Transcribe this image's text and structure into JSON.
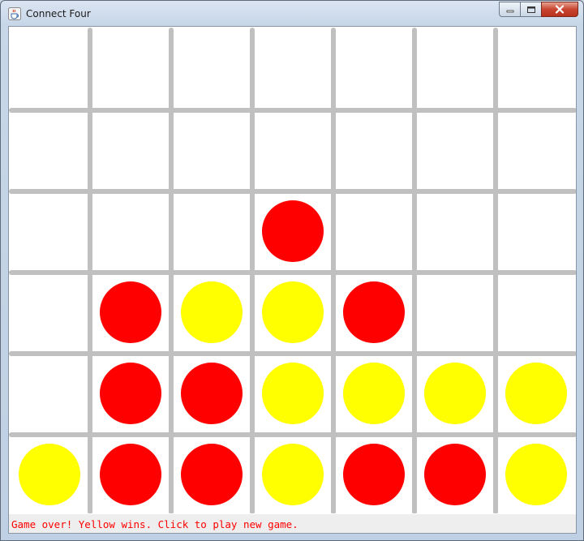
{
  "window": {
    "title": "Connect Four",
    "icon": "java-coffee-cup-icon"
  },
  "caption_buttons": [
    "minimize-icon",
    "maximize-icon",
    "close-icon"
  ],
  "colors": {
    "red_piece": "#ff0000",
    "yellow_piece": "#ffff00",
    "grid_line": "#c0c0c0",
    "board_background": "#ffffff",
    "status_text": "#ff0000"
  },
  "board": {
    "rows": 6,
    "columns": 7,
    "cells": [
      [
        "",
        "",
        "",
        "",
        "",
        "",
        ""
      ],
      [
        "",
        "",
        "",
        "",
        "",
        "",
        ""
      ],
      [
        "",
        "",
        "",
        "R",
        "",
        "",
        ""
      ],
      [
        "",
        "R",
        "Y",
        "Y",
        "R",
        "",
        ""
      ],
      [
        "",
        "R",
        "R",
        "Y",
        "Y",
        "Y",
        "Y"
      ],
      [
        "Y",
        "R",
        "R",
        "Y",
        "R",
        "R",
        "Y"
      ]
    ]
  },
  "status": {
    "message": "Game over! Yellow wins. Click to play new game."
  }
}
